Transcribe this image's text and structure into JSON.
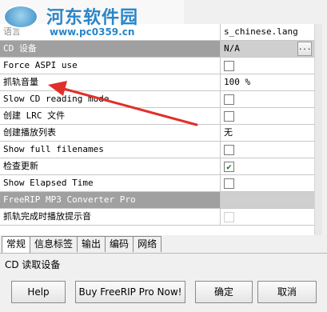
{
  "watermark": {
    "badge_text": "",
    "title": "河东软件园",
    "url": "www.pc0359.cn",
    "overlaid_left_text": "常规"
  },
  "settings": [
    {
      "name": "语言",
      "value": "s_chinese.lang",
      "type": "text"
    },
    {
      "name": "CD 设备",
      "value": "N/A",
      "type": "text-browse",
      "section": true,
      "browse_label": "..."
    },
    {
      "name": "Force ASPI use",
      "value": "",
      "type": "checkbox",
      "checked": false
    },
    {
      "name": "抓轨音量",
      "value": "100 %",
      "type": "text"
    },
    {
      "name": "Slow CD reading mode",
      "value": "",
      "type": "checkbox",
      "checked": false
    },
    {
      "name": "创建 LRC 文件",
      "value": "",
      "type": "checkbox",
      "checked": false
    },
    {
      "name": "创建播放列表",
      "value": "无",
      "type": "text"
    },
    {
      "name": "Show full filenames",
      "value": "",
      "type": "checkbox",
      "checked": false
    },
    {
      "name": "检查更新",
      "value": "",
      "type": "checkbox",
      "checked": true
    },
    {
      "name": "Show Elapsed Time",
      "value": "",
      "type": "checkbox",
      "checked": false
    },
    {
      "name": "FreeRIP MP3 Converter Pro",
      "value": "",
      "type": "section"
    },
    {
      "name": "抓轨完成时播放提示音",
      "value": "",
      "type": "checkbox-dim",
      "checked": false
    }
  ],
  "tabs": [
    "常规",
    "信息标签",
    "输出",
    "编码",
    "网络"
  ],
  "active_tab": 0,
  "status_text": "CD 读取设备",
  "buttons": {
    "help": "Help",
    "buy": "Buy FreeRIP Pro Now!",
    "ok": "确定",
    "cancel": "取消"
  },
  "colors": {
    "accent": "#2a85c8",
    "annotation_arrow": "#e0302a",
    "check": "#1a7a1a"
  }
}
